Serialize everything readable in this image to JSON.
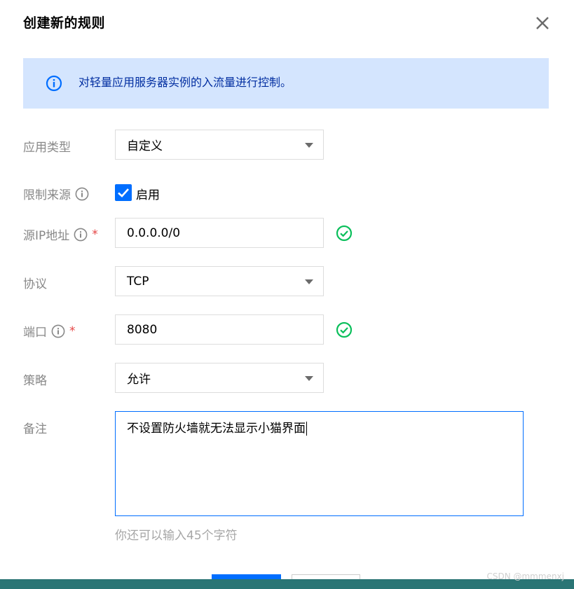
{
  "dialog": {
    "title": "创建新的规则",
    "close_icon": "close-icon"
  },
  "notice": {
    "icon": "info-circle-icon",
    "text": "对轻量应用服务器实例的入流量进行控制。",
    "bg_color": "#d4e5fe",
    "text_color": "#002da0"
  },
  "form": {
    "app_type": {
      "label": "应用类型",
      "value": "自定义"
    },
    "source_limit": {
      "label": "限制来源",
      "checkbox_label": "启用",
      "checked": true
    },
    "source_ip": {
      "label": "源IP地址",
      "required_mark": "*",
      "value": "0.0.0.0/0",
      "valid": true
    },
    "protocol": {
      "label": "协议",
      "value": "TCP"
    },
    "port": {
      "label": "端口",
      "required_mark": "*",
      "value": "8080",
      "valid": true
    },
    "policy": {
      "label": "策略",
      "value": "允许"
    },
    "remark": {
      "label": "备注",
      "value": "不设置防火墙就无法显示小猫界面",
      "hint": "你还可以输入45个字符"
    }
  },
  "colors": {
    "primary": "#006eff",
    "valid": "#0abf5b",
    "required": "#e54545"
  },
  "watermark": "CSDN @mmmenxj"
}
